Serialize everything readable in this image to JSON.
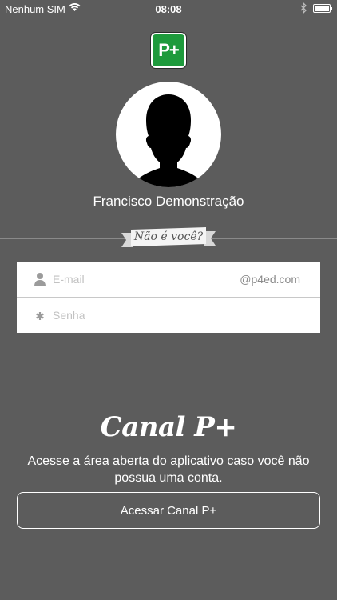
{
  "status_bar": {
    "carrier": "Nenhum SIM",
    "time": "08:08",
    "battery_level": 1.0,
    "icons": [
      "wifi-icon",
      "bluetooth-icon",
      "battery-icon"
    ]
  },
  "logo": {
    "text": "P+",
    "color": "#1e9a3c"
  },
  "user": {
    "name": "Francisco Demonstração",
    "avatar_icon": "person-silhouette-icon"
  },
  "not_you_label": "Não é você?",
  "login_form": {
    "email_placeholder": "E-mail",
    "email_suffix": "@p4ed.com",
    "password_placeholder": "Senha",
    "email_icon": "user-icon",
    "password_icon": "asterisk-icon"
  },
  "canal": {
    "title": "Canal P+",
    "description": "Acesse a área aberta do aplicativo caso você não possua uma conta.",
    "button_label": "Acessar Canal P+"
  },
  "colors": {
    "background": "#5c5c5c",
    "brand_green": "#1e9a3c",
    "form_background": "#ffffff"
  }
}
